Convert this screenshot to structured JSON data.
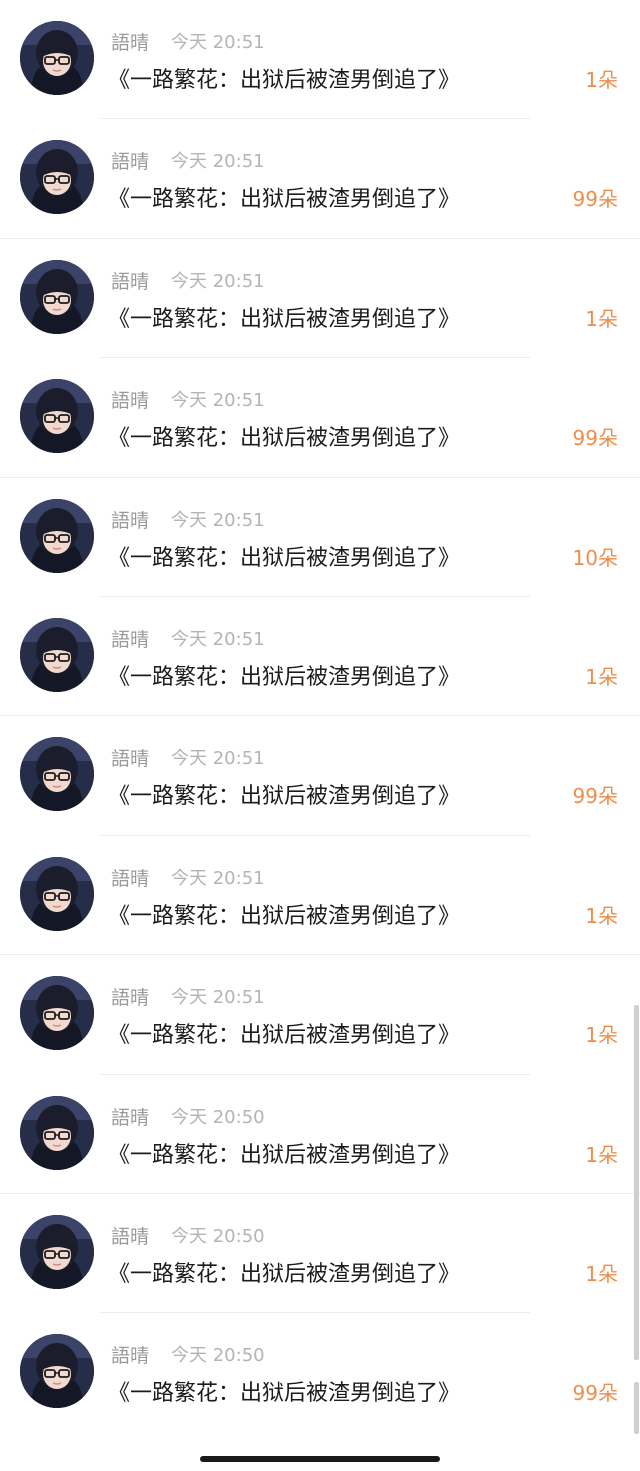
{
  "rows": [
    {
      "name": "語晴",
      "time": "今天 20:51",
      "title": "《一路繁花：出狱后被渣男倒追了》",
      "count": "1朵",
      "divider": "short"
    },
    {
      "name": "語晴",
      "time": "今天 20:51",
      "title": "《一路繁花：出狱后被渣男倒追了》",
      "count": "99朵",
      "divider": "full"
    },
    {
      "name": "語晴",
      "time": "今天 20:51",
      "title": "《一路繁花：出狱后被渣男倒追了》",
      "count": "1朵",
      "divider": "short"
    },
    {
      "name": "語晴",
      "time": "今天 20:51",
      "title": "《一路繁花：出狱后被渣男倒追了》",
      "count": "99朵",
      "divider": "full"
    },
    {
      "name": "語晴",
      "time": "今天 20:51",
      "title": "《一路繁花：出狱后被渣男倒追了》",
      "count": "10朵",
      "divider": "short"
    },
    {
      "name": "語晴",
      "time": "今天 20:51",
      "title": "《一路繁花：出狱后被渣男倒追了》",
      "count": "1朵",
      "divider": "full"
    },
    {
      "name": "語晴",
      "time": "今天 20:51",
      "title": "《一路繁花：出狱后被渣男倒追了》",
      "count": "99朵",
      "divider": "short"
    },
    {
      "name": "語晴",
      "time": "今天 20:51",
      "title": "《一路繁花：出狱后被渣男倒追了》",
      "count": "1朵",
      "divider": "full"
    },
    {
      "name": "語晴",
      "time": "今天 20:51",
      "title": "《一路繁花：出狱后被渣男倒追了》",
      "count": "1朵",
      "divider": "short"
    },
    {
      "name": "語晴",
      "time": "今天 20:50",
      "title": "《一路繁花：出狱后被渣男倒追了》",
      "count": "1朵",
      "divider": "full"
    },
    {
      "name": "語晴",
      "time": "今天 20:50",
      "title": "《一路繁花：出狱后被渣男倒追了》",
      "count": "1朵",
      "divider": "short"
    },
    {
      "name": "語晴",
      "time": "今天 20:50",
      "title": "《一路繁花：出狱后被渣男倒追了》",
      "count": "99朵",
      "divider": "none"
    }
  ],
  "colors": {
    "count": "#ee8e4a",
    "name": "#9a9a9a",
    "time": "#b4b4b4",
    "title": "#1c1c1c"
  },
  "icons": {
    "avatar": "user-avatar-photo"
  }
}
